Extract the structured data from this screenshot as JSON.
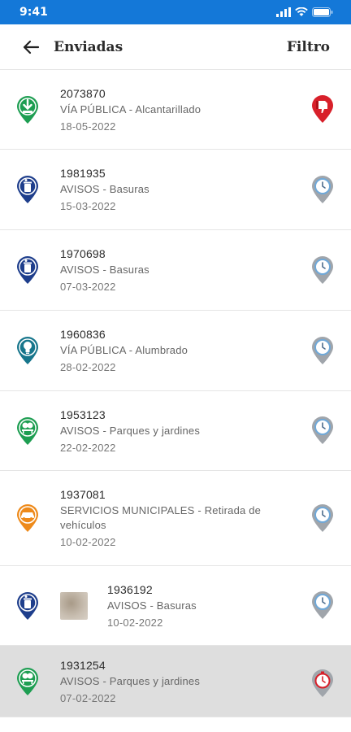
{
  "status_bar": {
    "time": "9:41"
  },
  "app_bar": {
    "title": "Enviadas",
    "filter_label": "Filtro"
  },
  "colors": {
    "accent": "#1478d8",
    "green": "#1e9e52",
    "navy": "#1e3e8c",
    "teal": "#17768c",
    "orange": "#ee8a1a",
    "red": "#d8202a"
  },
  "items": [
    {
      "number": "2073870",
      "category": "VÍA PÚBLICA - Alcantarillado",
      "date": "18-05-2022",
      "category_icon": "sewer-icon",
      "status_icon": "thumbs-down-icon"
    },
    {
      "number": "1981935",
      "category": "AVISOS - Basuras",
      "date": "15-03-2022",
      "category_icon": "trash-icon",
      "status_icon": "clock-icon"
    },
    {
      "number": "1970698",
      "category": "AVISOS - Basuras",
      "date": "07-03-2022",
      "category_icon": "trash-icon",
      "status_icon": "clock-icon"
    },
    {
      "number": "1960836",
      "category": "VÍA PÚBLICA - Alumbrado",
      "date": "28-02-2022",
      "category_icon": "lightbulb-icon",
      "status_icon": "clock-icon"
    },
    {
      "number": "1953123",
      "category": "AVISOS - Parques y jardines",
      "date": "22-02-2022",
      "category_icon": "park-icon",
      "status_icon": "clock-icon"
    },
    {
      "number": "1937081",
      "category": "SERVICIOS MUNICIPALES - Retirada de vehículos",
      "date": "10-02-2022",
      "category_icon": "car-icon",
      "status_icon": "clock-icon"
    },
    {
      "number": "1936192",
      "category": "AVISOS - Basuras",
      "date": "10-02-2022",
      "category_icon": "trash-icon",
      "status_icon": "clock-icon"
    },
    {
      "number": "1931254",
      "category": "AVISOS - Parques y jardines",
      "date": "07-02-2022",
      "category_icon": "park-icon",
      "status_icon": "stopwatch-icon"
    }
  ]
}
